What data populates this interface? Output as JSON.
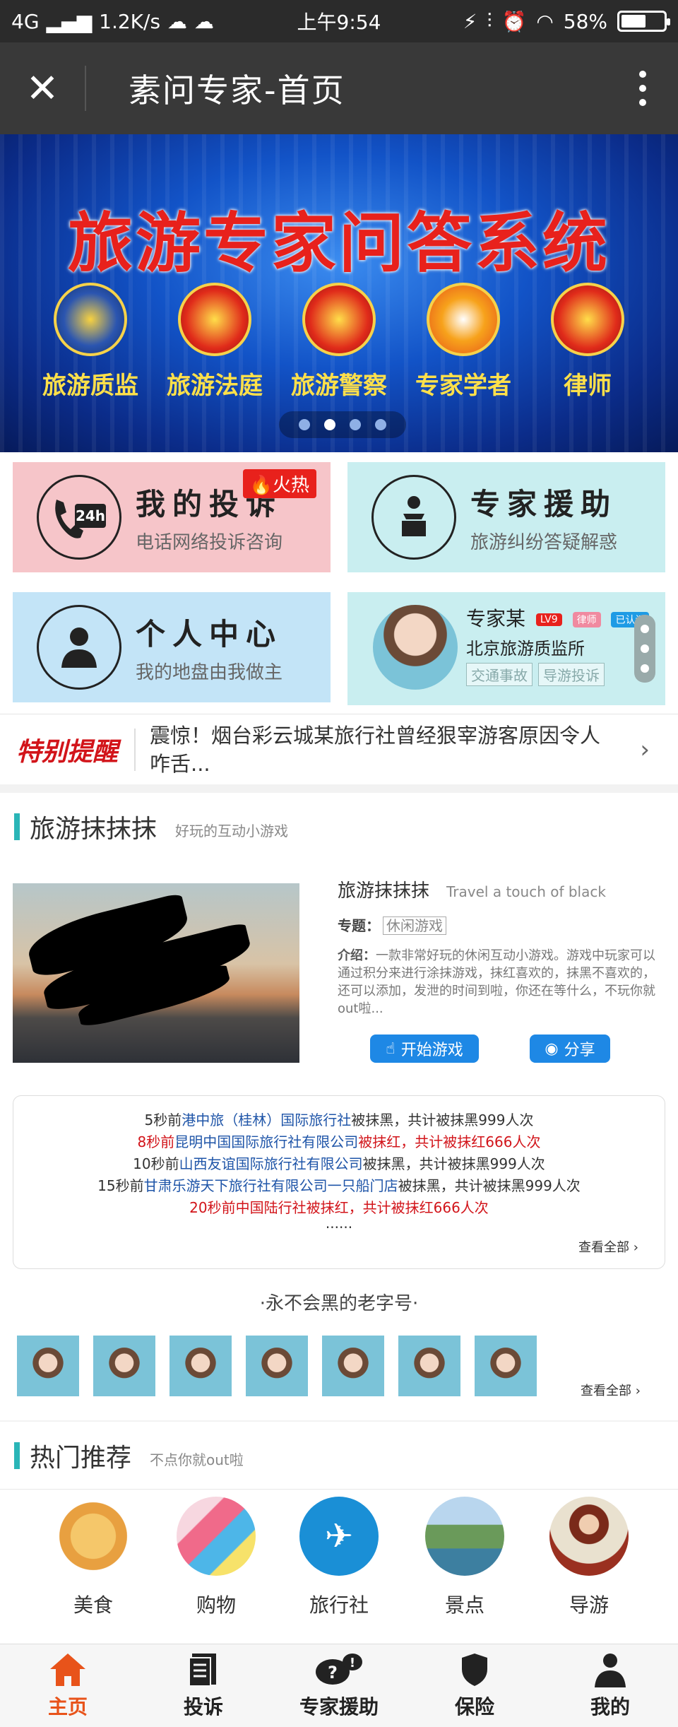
{
  "status_bar": {
    "network": "4G",
    "speed": "1.2K/s",
    "time": "上午9:54",
    "battery": "58%",
    "battery_level": 0.58
  },
  "title_bar": {
    "title": "素问专家-首页"
  },
  "banner": {
    "title": "旅游专家问答系统",
    "emblems": [
      "旅游质监",
      "旅游法庭",
      "旅游警察",
      "专家学者",
      "律师"
    ],
    "page_count": 4,
    "active_page": 2
  },
  "tiles": {
    "complaint": {
      "title": "我的投诉",
      "subtitle": "电话网络投诉咨询",
      "badge": "火热",
      "icon_text": "24h"
    },
    "expert_help": {
      "title": "专家援助",
      "subtitle": "旅游纠纷答疑解惑"
    },
    "personal": {
      "title": "个人中心",
      "subtitle": "我的地盘由我做主"
    },
    "expert_card": {
      "name": "专家某",
      "badges": [
        "LV9",
        "律师",
        "已认证"
      ],
      "org": "北京旅游质监所",
      "tags": [
        "交通事故",
        "导游投诉"
      ]
    }
  },
  "notice": {
    "tag": "特别提醒",
    "text": "震惊！烟台彩云城某旅行社曾经狠宰游客原因令人咋舌..."
  },
  "game_section": {
    "title": "旅游抹抹抹",
    "subtitle": "好玩的互动小游戏",
    "game_name": "旅游抹抹抹",
    "game_name_en": "Travel a touch of black",
    "topic_label": "专题：",
    "topic": "休闲游戏",
    "desc_label": "介绍：",
    "desc": "一款非常好玩的休闲互动小游戏。游戏中玩家可以通过积分来进行涂抹游戏，抹红喜欢的，抹黑不喜欢的，还可以添加，发泄的时间到啦，你还在等什么，不玩你就out啦...",
    "start_button": "开始游戏",
    "share_button": "分享",
    "board": [
      {
        "prefix": "5秒前",
        "company": "港中旅（桂林）国际旅行社",
        "suffix": "被抹黑，共计被抹黑999人次",
        "red": false
      },
      {
        "prefix": "8秒前",
        "company": "昆明中国国际旅行社有限公司",
        "suffix": "被抹红，共计被抹红666人次",
        "red": true
      },
      {
        "prefix": "10秒前",
        "company": "山西友谊国际旅行社有限公司",
        "suffix": "被抹黑，共计被抹黑999人次",
        "red": false
      },
      {
        "prefix": "15秒前",
        "company": "甘肃乐游天下旅行社有限公司一只船门店",
        "suffix": "被抹黑，共计被抹黑999人次",
        "red": false
      },
      {
        "prefix": "20秒前",
        "company": "中国陆行社",
        "suffix": "被抹红，共计被抹红666人次",
        "red": true
      }
    ],
    "ellipsis": "......",
    "see_all": "查看全部",
    "old_brand_title": "·永不会黑的老字号·",
    "old_brand_see_all": "查看全部"
  },
  "hot_section": {
    "title": "热门推荐",
    "subtitle": "不点你就out啦",
    "items": [
      "美食",
      "购物",
      "旅行社",
      "景点",
      "导游"
    ]
  },
  "tab_bar": {
    "tabs": [
      "主页",
      "投诉",
      "专家援助",
      "保险",
      "我的"
    ],
    "active": 0
  },
  "colors": {
    "accent": "#2ab5b7",
    "active_tab": "#e8531a",
    "alert_red": "#d2141a",
    "link_blue": "#1f55a8",
    "tile_pink": "#f6c5c9",
    "tile_cyan": "#c9eef0",
    "tile_blue": "#c3e4f7"
  }
}
